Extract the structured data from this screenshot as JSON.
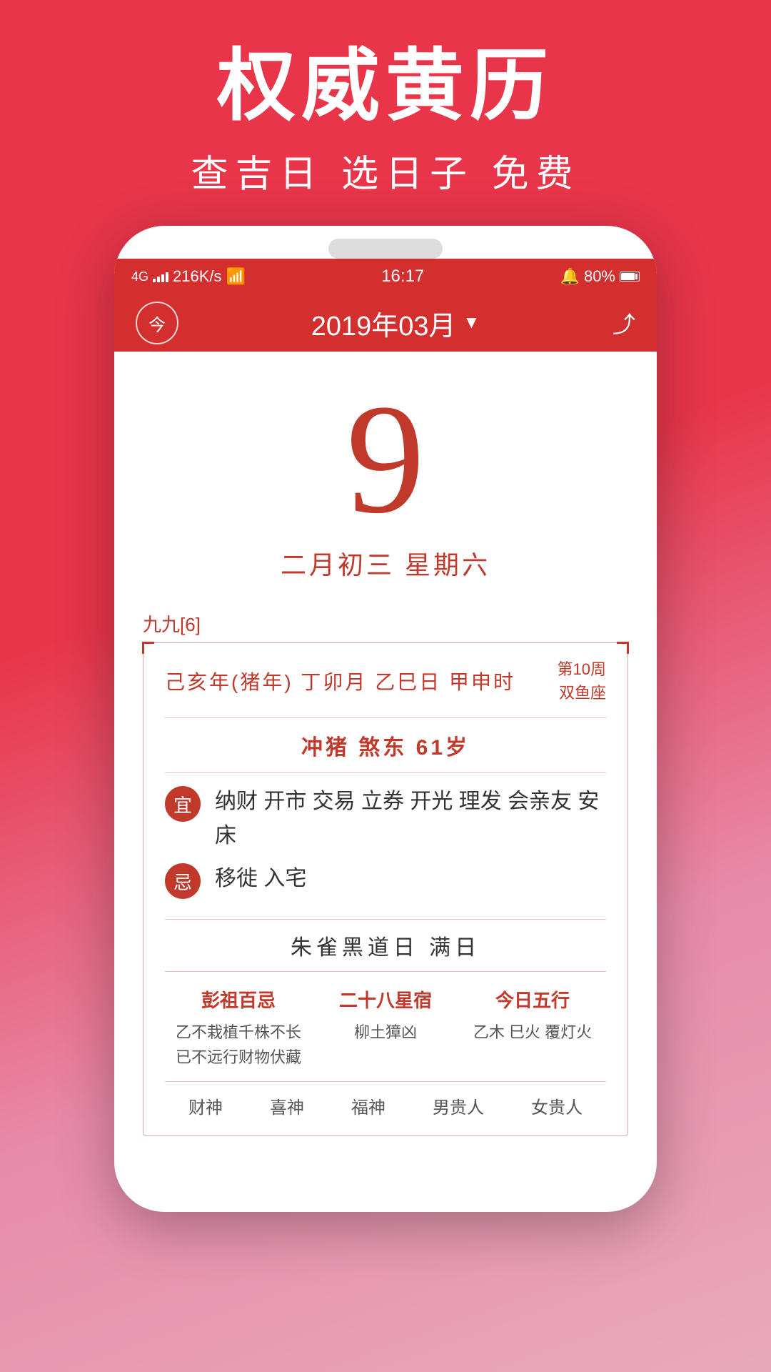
{
  "background": {
    "gradient_start": "#e8354a",
    "gradient_end": "#e8aabb"
  },
  "app": {
    "title": "权威黄历",
    "subtitle": "查吉日 选日子 免费"
  },
  "status_bar": {
    "network": "4G",
    "speed": "216K/s",
    "wifi": "WiFi",
    "time": "16:17",
    "alarm": "🔔",
    "battery_percent": "80%"
  },
  "nav_bar": {
    "today_label": "今",
    "title": "2019年03月",
    "arrow": "▼"
  },
  "date_display": {
    "day": "9",
    "lunar_date": "二月初三  星期六"
  },
  "info_section": {
    "section_label": "九九[6]",
    "ganzhi": {
      "main": "己亥年(猪年) 丁卯月 乙巳日 甲申时",
      "week": "第10周",
      "zodiac": "双鱼座"
    },
    "chong": {
      "text": "冲猪  煞东  61岁"
    },
    "yi": {
      "badge": "宜",
      "content": "纳财 开市 交易 立券 开光 理发 会亲友 安床"
    },
    "ji": {
      "badge": "忌",
      "content": "移徙 入宅"
    },
    "zhuri": "朱雀黑道日  满日",
    "bottom_grid": [
      {
        "title": "彭祖百忌",
        "desc": "乙不栽植千株不长\n已不远行财物伏藏"
      },
      {
        "title": "二十八星宿",
        "desc": "柳土獐凶"
      },
      {
        "title": "今日五行",
        "desc": "乙木 巳火 覆灯火"
      }
    ],
    "footer_labels": [
      "财神",
      "喜神",
      "福神",
      "男贵人",
      "女贵人"
    ]
  }
}
